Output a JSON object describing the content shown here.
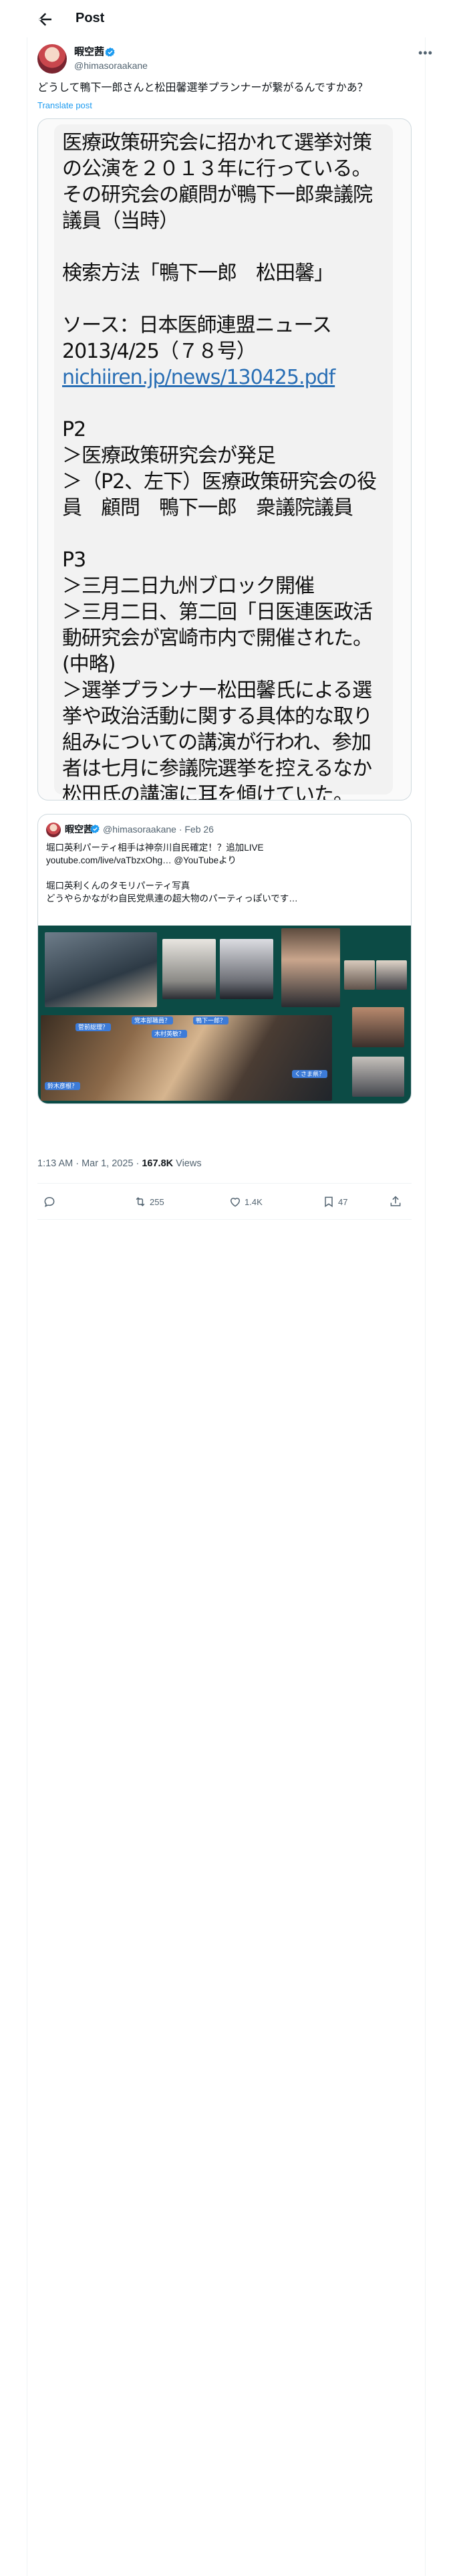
{
  "header": {
    "title": "Post"
  },
  "post": {
    "author_name": "暇空茜",
    "author_handle": "@himasoraakane",
    "text": "どうして鴨下一郎さんと松田馨選挙プランナーが繋がるんですかあ？",
    "translate_label": "Translate post",
    "media_text": {
      "lines": [
        "医療政策研究会に招かれて選挙対策",
        "の公演を２０１３年に行っている。",
        "その研究会の顧問が鴨下一郎衆議院",
        "議員（当時）",
        "",
        "検索方法「鴨下一郎　松田馨」",
        "",
        "ソース：日本医師連盟ニュース",
        " 2013/4/25（７８号）",
        "@@LINK@@",
        "",
        "P2",
        "＞医療政策研究会が発足",
        "＞（P2、左下）医療政策研究会の役",
        "員　顧問　鴨下一郎　衆議院議員",
        "",
        "P3",
        "＞三月二日九州ブロック開催",
        "＞三月二日、第二回「日医連医政活",
        "動研究会が宮崎市内で開催された。",
        "(中略)",
        "＞選挙プランナー松田馨氏による選",
        "挙や政治活動に関する具体的な取り",
        "組みについての講演が行われ、参加",
        "者は七月に参議院選挙を控えるなか",
        "松田氏の講演に耳を傾けていた。"
      ],
      "link_text": "nichiiren.jp/news/130425.pdf"
    }
  },
  "quote": {
    "author_name": "暇空茜",
    "author_handle": "@himasoraakane · Feb 26",
    "lines": [
      "堀口英利パーティ相手は神奈川自民確定！？追加LIVE",
      "youtube.com/live/vaTbzxOhg… @YouTubeより",
      "",
      "堀口英利くんのタモリパーティ写真",
      "どうやらかながわ自民党県連の超大物のパーティっぽいです…"
    ],
    "photo_tags": [
      "菅前総理？",
      "党本部職員？",
      "鴨下一郎？",
      "木村英敏？",
      "鈴木彦根？",
      "くさま県？"
    ]
  },
  "meta": {
    "time": "1:13 AM · Mar 1, 2025 · ",
    "views_count": "167.8K",
    "views_label": " Views"
  },
  "actions": {
    "reply_count": "",
    "repost_count": "255",
    "like_count": "1.4K",
    "bookmark_count": "47"
  },
  "colors": {
    "accent": "#1d9bf0",
    "verified": "#1d9bf0",
    "secondary_text": "#536471"
  }
}
